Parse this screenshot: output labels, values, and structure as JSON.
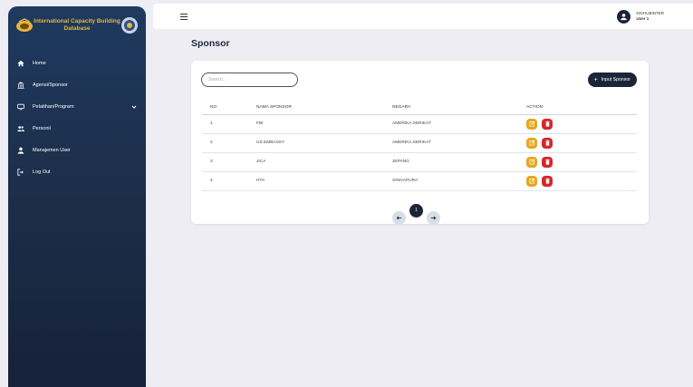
{
  "app": {
    "title_line1": "International Capacity Building",
    "title_line2": "Database"
  },
  "sidebar": {
    "items": [
      {
        "label": "Home",
        "icon": "home-icon"
      },
      {
        "label": "Agensi/Sponsor",
        "icon": "building-icon"
      },
      {
        "label": "Pelatihan/Program",
        "icon": "monitor-icon"
      },
      {
        "label": "Personil",
        "icon": "users-icon"
      },
      {
        "label": "Manajemen User",
        "icon": "user-icon"
      },
      {
        "label": "Log Out",
        "icon": "logout-icon"
      }
    ]
  },
  "topbar": {
    "user_role": "DIVHUBINTER",
    "user_name": "User 1"
  },
  "page": {
    "title": "Sponsor"
  },
  "search": {
    "placeholder": "Search...",
    "value": ""
  },
  "toolbar": {
    "input_label": "Input Sponsor",
    "plus": "+"
  },
  "table": {
    "headers": [
      "NO",
      "NAMA SPONSOR",
      "NEGARA",
      "ACTION"
    ],
    "rows": [
      {
        "no": "1",
        "sponsor": "FBI",
        "negara": "AMERIKA SERIKAT"
      },
      {
        "no": "2",
        "sponsor": "US EMBASSY",
        "negara": "AMERIKA SERIKAT"
      },
      {
        "no": "3",
        "sponsor": "JICA",
        "negara": "JEPANG"
      },
      {
        "no": "4",
        "sponsor": "HTA",
        "negara": "SINGAPURA"
      }
    ]
  },
  "pagination": {
    "current": "1"
  },
  "colors": {
    "sidebar_top": "#1f3a5f",
    "sidebar_bottom": "#16213a",
    "brand_gold": "#e3b63c",
    "primary": "#1c2538",
    "edit": "#e4a71f",
    "delete": "#d3282c"
  }
}
